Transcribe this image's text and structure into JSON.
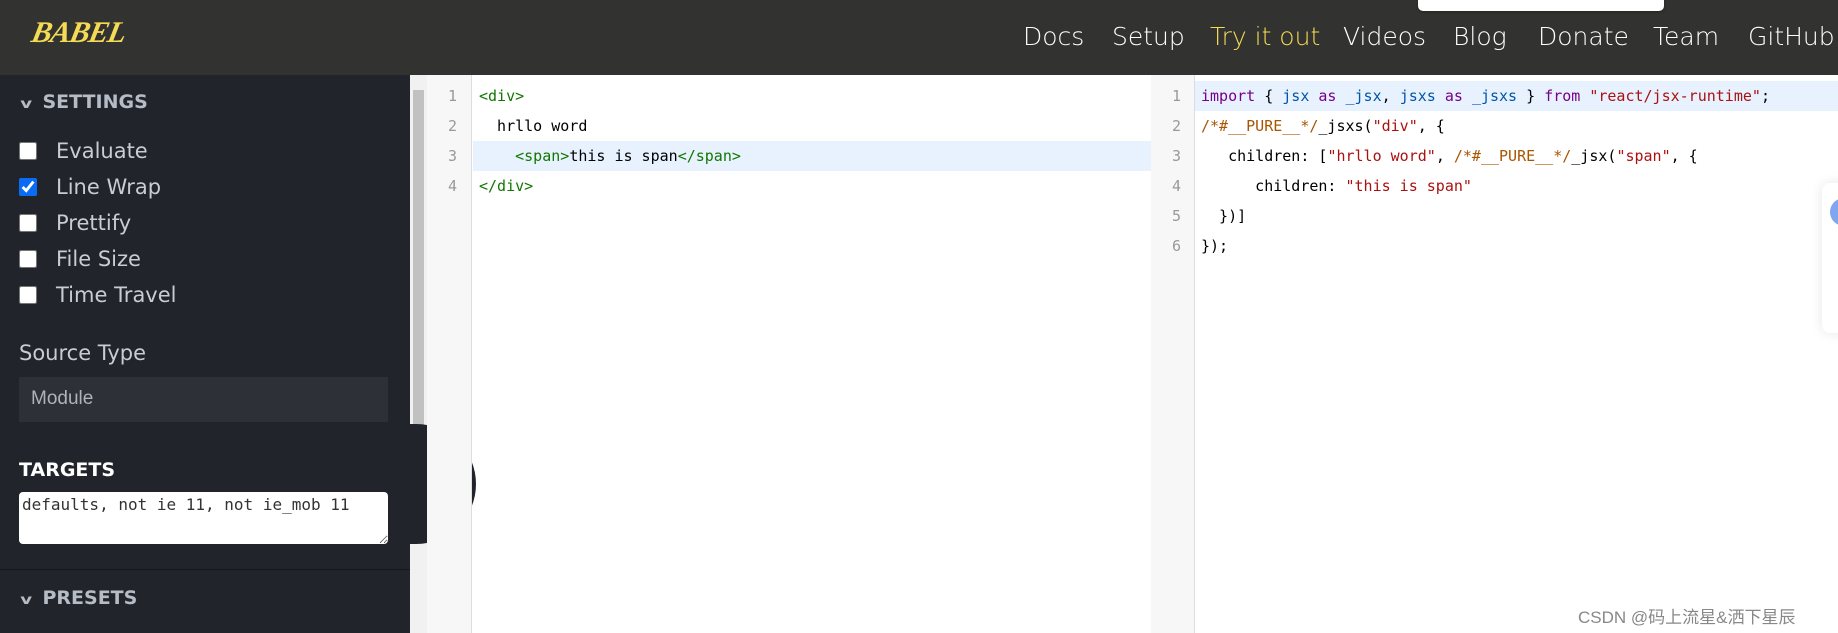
{
  "header": {
    "logo": "BABEL",
    "nav": [
      {
        "label": "Docs"
      },
      {
        "label": "Setup"
      },
      {
        "label": "Try it out",
        "active": true
      },
      {
        "label": "Videos"
      },
      {
        "label": "Blog"
      },
      {
        "label": "Donate"
      },
      {
        "label": "Team"
      },
      {
        "label": "GitHub"
      }
    ],
    "accent": "#f5da55"
  },
  "sidebar": {
    "settings_title": "SETTINGS",
    "options": [
      {
        "label": "Evaluate",
        "checked": false
      },
      {
        "label": "Line Wrap",
        "checked": true
      },
      {
        "label": "Prettify",
        "checked": false
      },
      {
        "label": "File Size",
        "checked": false
      },
      {
        "label": "Time Travel",
        "checked": false
      }
    ],
    "source_type_label": "Source Type",
    "source_type_value": "Module",
    "targets_title": "TARGETS",
    "targets_value": "defaults, not ie 11, not ie_mob 11",
    "presets_title": "PRESETS",
    "collapse_icon": "chevron-left-icon"
  },
  "input_editor": {
    "lines": [
      "1",
      "2",
      "3",
      "4"
    ],
    "code": [
      "<div>",
      "  hrllo word",
      "    <span>this is span</span>",
      "</div>"
    ]
  },
  "output_editor": {
    "lines": [
      "1",
      "2",
      "3",
      "4",
      "5",
      "6"
    ]
  },
  "watermark": "CSDN @码上流星&洒下星辰"
}
